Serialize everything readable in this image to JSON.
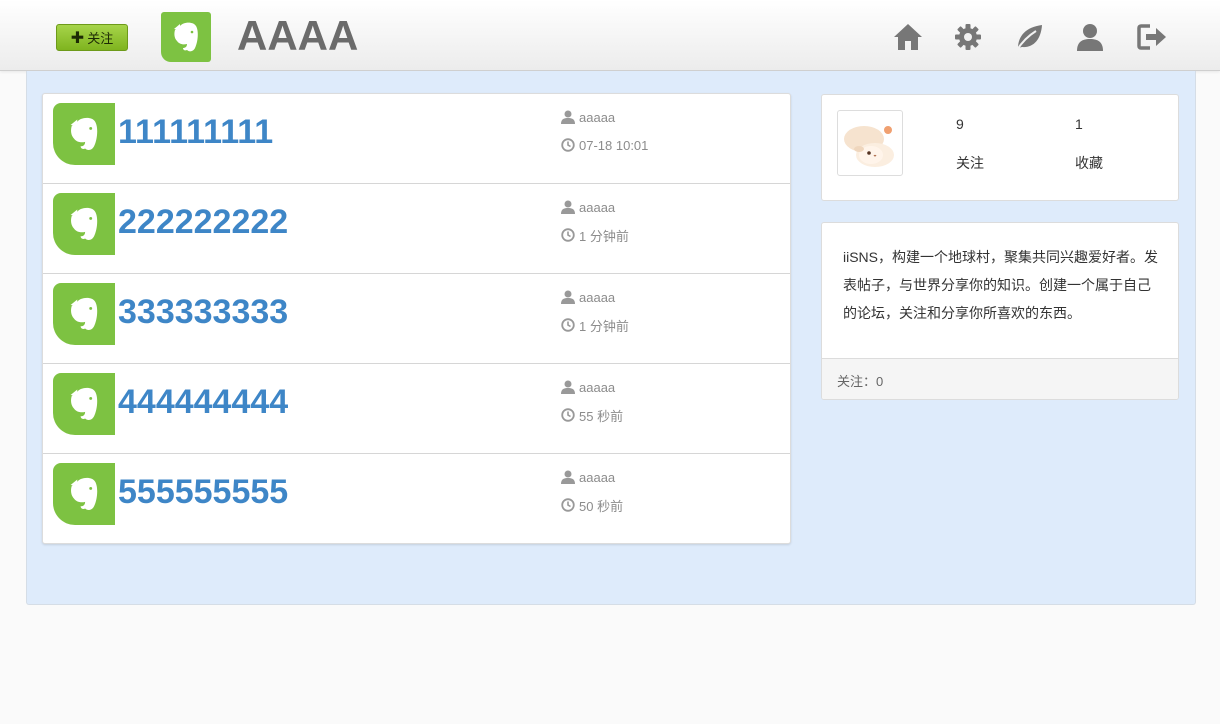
{
  "header": {
    "follow_button": {
      "icon": "plus-icon",
      "label": "关注"
    },
    "brand": {
      "logo_icon": "evernote-elephant-icon",
      "title": "AAAA"
    },
    "nav_icons": [
      "home-icon",
      "gear-icon",
      "leaf-icon",
      "user-icon",
      "sign-out-icon"
    ]
  },
  "posts": [
    {
      "title": "111111111",
      "author": "aaaaa",
      "time": "07-18 10:01"
    },
    {
      "title": "222222222",
      "author": "aaaaa",
      "time": "1 分钟前"
    },
    {
      "title": "333333333",
      "author": "aaaaa",
      "time": "1 分钟前"
    },
    {
      "title": "444444444",
      "author": "aaaaa",
      "time": "55 秒前"
    },
    {
      "title": "555555555",
      "author": "aaaaa",
      "time": "50 秒前"
    }
  ],
  "profile": {
    "avatar_icon": "mushroom-avatar",
    "following_count": "9",
    "following_label": "关注",
    "favorites_count": "1",
    "favorites_label": "收藏"
  },
  "about": {
    "text": "iiSNS，构建一个地球村，聚集共同兴趣爱好者。发表帖子，与世界分享你的知识。创建一个属于自己的论坛，关注和分享你所喜欢的东西。",
    "footer": "关注：0"
  },
  "colors": {
    "accent_green": "#7dc242",
    "link_blue": "#3e86c7",
    "content_bg": "#deebfb"
  }
}
